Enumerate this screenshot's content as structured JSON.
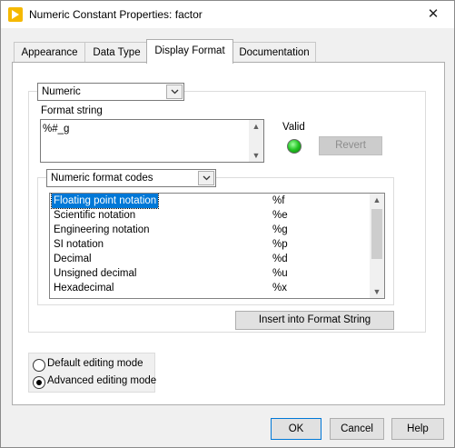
{
  "window": {
    "title": "Numeric Constant Properties: factor",
    "close_glyph": "✕"
  },
  "tabs": [
    {
      "label": "Appearance"
    },
    {
      "label": "Data Type"
    },
    {
      "label": "Display Format",
      "active": true
    },
    {
      "label": "Documentation"
    }
  ],
  "display_format": {
    "type_select": "Numeric",
    "format_string_label": "Format string",
    "format_string_value": "%#_g",
    "valid_label": "Valid",
    "valid_color": "#22c322",
    "revert_button": "Revert",
    "codes_select": "Numeric format codes",
    "codes": [
      {
        "name": "Floating point notation",
        "code": "%f",
        "selected": true
      },
      {
        "name": "Scientific notation",
        "code": "%e"
      },
      {
        "name": "Engineering notation",
        "code": "%g"
      },
      {
        "name": "SI notation",
        "code": "%p"
      },
      {
        "name": "Decimal",
        "code": "%d"
      },
      {
        "name": "Unsigned decimal",
        "code": "%u"
      },
      {
        "name": "Hexadecimal",
        "code": "%x"
      }
    ],
    "insert_button": "Insert into Format String"
  },
  "editing_mode": {
    "options": [
      {
        "label": "Default editing mode",
        "checked": false
      },
      {
        "label": "Advanced editing mode",
        "checked": true
      }
    ]
  },
  "footer": {
    "ok": "OK",
    "cancel": "Cancel",
    "help": "Help"
  },
  "colors": {
    "selection": "#0078d7",
    "app_icon": "#f5b800"
  }
}
